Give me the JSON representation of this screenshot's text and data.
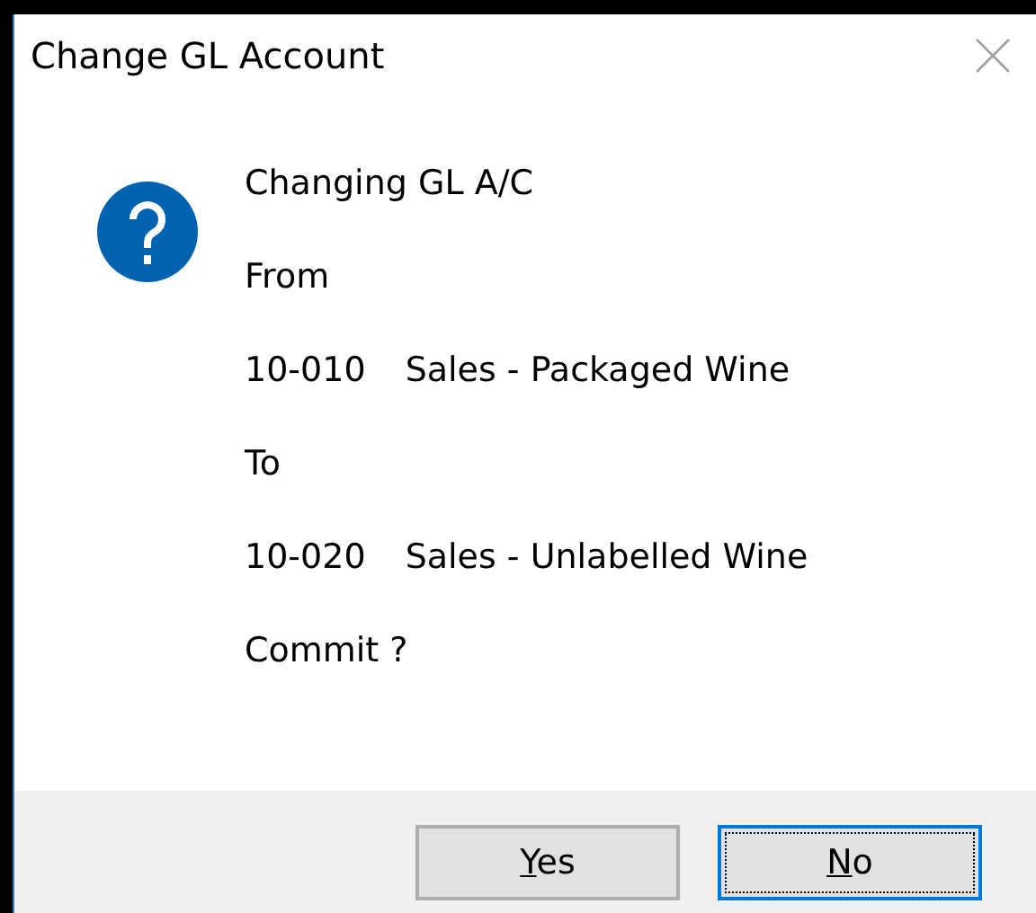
{
  "window": {
    "title": "Change GL Account",
    "close_enabled": false
  },
  "message": {
    "lines": [
      {
        "kind": "text",
        "text": "Changing GL A/C"
      },
      {
        "kind": "text",
        "text": "From"
      },
      {
        "kind": "account",
        "code": "10-010",
        "name": "Sales - Packaged Wine"
      },
      {
        "kind": "text",
        "text": "To"
      },
      {
        "kind": "account",
        "code": "10-020",
        "name": "Sales - Unlabelled Wine"
      },
      {
        "kind": "text",
        "text": "Commit ?"
      }
    ]
  },
  "buttons": [
    {
      "label": "Yes",
      "focused": false,
      "underline_first": true
    },
    {
      "label": "No",
      "focused": true,
      "underline_first": true
    }
  ]
}
